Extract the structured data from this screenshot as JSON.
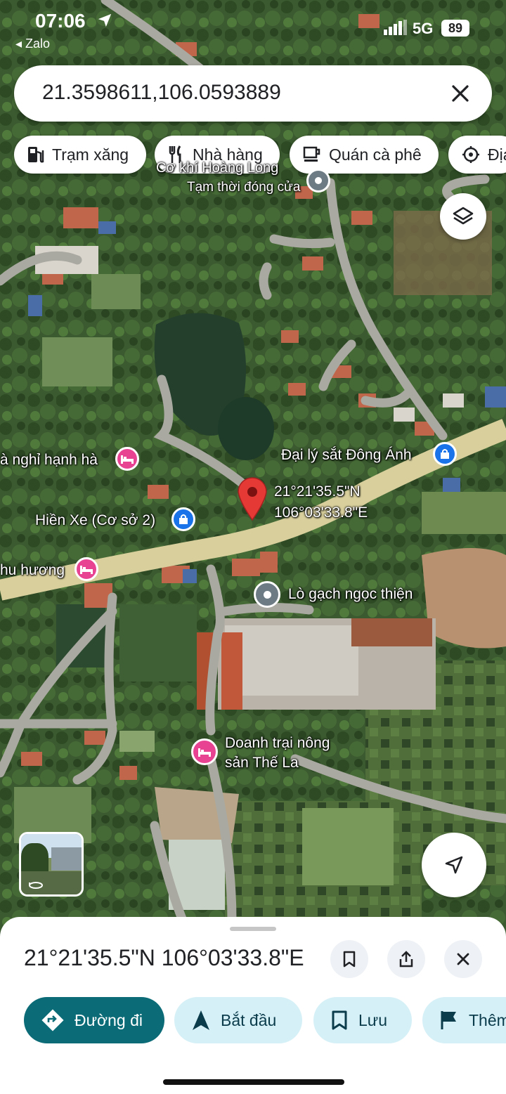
{
  "status_bar": {
    "time": "07:06",
    "back_app": "◂ Zalo",
    "network": "5G",
    "battery": "89"
  },
  "search": {
    "query": "21.3598611,106.0593889"
  },
  "chips": [
    {
      "label": "Trạm xăng",
      "icon": "gas-station-icon"
    },
    {
      "label": "Nhà hàng",
      "icon": "restaurant-icon"
    },
    {
      "label": "Quán cà phê",
      "icon": "coffee-icon"
    },
    {
      "label": "Địa",
      "icon": "attraction-icon"
    }
  ],
  "map": {
    "top_place": "Cơ khí Hoàng Long",
    "top_place_status": "Tạm thời đóng cửa",
    "dropped_pin_lat": "21°21'35.5\"N",
    "dropped_pin_lng": "106°03'33.8\"E",
    "places": {
      "hotel_left": "à nghỉ hạnh hà",
      "hien_xe": "Hiền Xe (Cơ sở 2)",
      "hotel_nhu": "hu hương",
      "dai_ly": "Đại lý sắt Đông Ánh",
      "lo_gach": "Lò gạch ngọc thiện",
      "doanh_trai_1": "Doanh trại nông",
      "doanh_trai_2": "sản Thế La"
    }
  },
  "sheet": {
    "title": "21°21'35.5\"N 106°03'33.8\"E",
    "actions": {
      "directions": "Đường đi",
      "start": "Bắt đầu",
      "save": "Lưu",
      "more": "Thêm"
    }
  },
  "colors": {
    "primary": "#0b6b76",
    "action_bg": "#d6f0f7",
    "pin_red": "#e53935",
    "hotel_pink": "#e84393",
    "shop_blue": "#1a73e8"
  }
}
